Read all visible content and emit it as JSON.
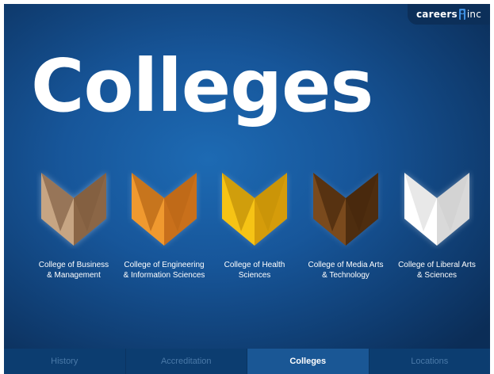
{
  "brand": {
    "name_left": "careers",
    "name_right": "inc",
    "logo_icon": "person-mark-icon"
  },
  "page_title": "Colleges",
  "colleges": [
    {
      "label": "College of Business\n& Management",
      "left": "#c7a583",
      "right": "#8b6646",
      "fold": "#6f4f34"
    },
    {
      "label": "College of Engineering\n& Information Sciences",
      "left": "#f0992f",
      "right": "#c9701b",
      "fold": "#a6570f"
    },
    {
      "label": "College of Health\nSciences",
      "left": "#f6c315",
      "right": "#d59c0a",
      "fold": "#b07f05"
    },
    {
      "label": "College of Media Arts\n& Technology",
      "left": "#7a4a1d",
      "right": "#4e2d0f",
      "fold": "#3a1f08"
    },
    {
      "label": "College of Liberal Arts\n& Sciences",
      "left": "#ffffff",
      "right": "#d9d9d9",
      "fold": "#bdbdbd"
    }
  ],
  "tabs": [
    {
      "label": "History",
      "active": false
    },
    {
      "label": "Accreditation",
      "active": false
    },
    {
      "label": "Colleges",
      "active": true
    },
    {
      "label": "Locations",
      "active": false
    }
  ]
}
